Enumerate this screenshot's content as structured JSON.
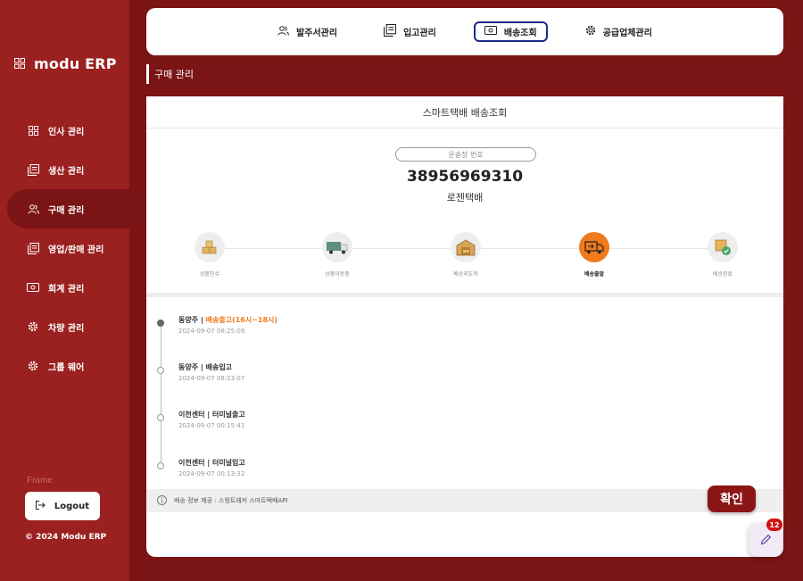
{
  "brand": {
    "name": "modu ERP"
  },
  "sidebar": {
    "items": [
      {
        "label": "인사 관리",
        "icon": "grid-icon"
      },
      {
        "label": "생산 관리",
        "icon": "document-stack-icon"
      },
      {
        "label": "구매 관리",
        "icon": "users-icon",
        "active": true
      },
      {
        "label": "영업/판매 관리",
        "icon": "document-stack-icon"
      },
      {
        "label": "회계 관리",
        "icon": "money-icon"
      },
      {
        "label": "차량 관리",
        "icon": "gear-icon"
      },
      {
        "label": "그룹 웨어",
        "icon": "gear-icon"
      }
    ],
    "frame_label": "Frame",
    "logout_label": "Logout",
    "copyright": "© 2024 Modu ERP"
  },
  "tabs": [
    {
      "label": "발주서관리",
      "icon": "users-icon"
    },
    {
      "label": "입고관리",
      "icon": "document-stack-icon"
    },
    {
      "label": "배송조회",
      "icon": "money-icon",
      "active": true
    },
    {
      "label": "공급업체관리",
      "icon": "gear-icon"
    }
  ],
  "breadcrumb": "구매 관리",
  "card": {
    "title": "스마트택배 배송조회",
    "tracking_label": "운송장 번호",
    "tracking_number": "38956969310",
    "carrier": "로젠택배"
  },
  "steps": [
    {
      "label": "상품인수",
      "icon": "boxes-icon"
    },
    {
      "label": "상품이동중",
      "icon": "truck-icon"
    },
    {
      "label": "배송지도착",
      "icon": "warehouse-icon"
    },
    {
      "label": "배송출발",
      "icon": "delivery-truck-icon",
      "active": true
    },
    {
      "label": "배송완료",
      "icon": "box-check-icon"
    }
  ],
  "timeline": [
    {
      "place": "동양주",
      "sep": " | ",
      "status": "배송출고(16시~18시)",
      "highlight": true,
      "time": "2024-09-07 08:25:09"
    },
    {
      "place": "동양주",
      "sep": " | ",
      "status": "배송입고",
      "highlight": false,
      "time": "2024-09-07 08:23:07"
    },
    {
      "place": "이천센터",
      "sep": " | ",
      "status": "터미널출고",
      "highlight": false,
      "time": "2024-09-07 00:15:41"
    },
    {
      "place": "이천센터",
      "sep": " | ",
      "status": "터미널입고",
      "highlight": false,
      "time": "2024-09-07 00:13:32"
    }
  ],
  "footer_note": "배송 정보 제공 : 스윗트래커 스마트택배API",
  "confirm_label": "확인",
  "notification_count": "12",
  "colors": {
    "sidebar": "#9b2020",
    "background": "#7b1414",
    "accent": "#f07a1c",
    "tab_active_border": "#1a2b8a"
  }
}
